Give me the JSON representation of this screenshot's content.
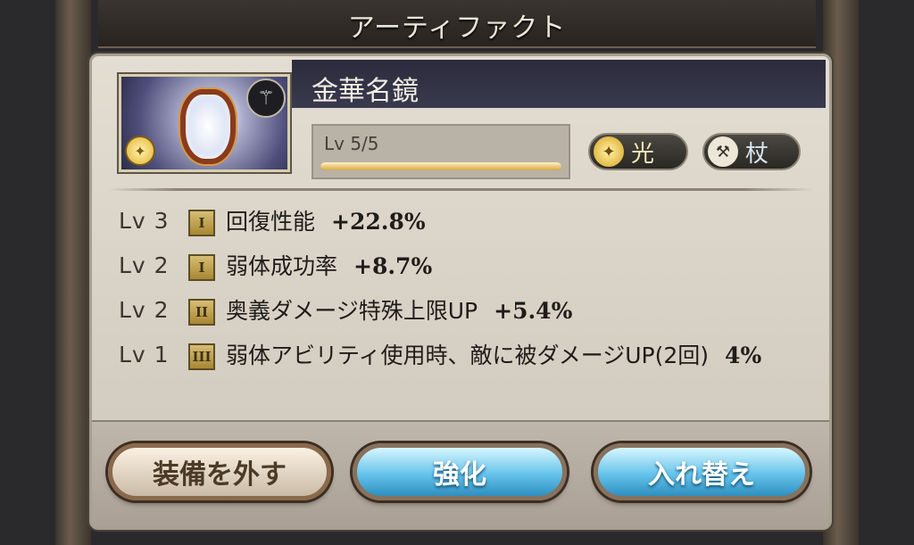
{
  "header": {
    "title": "アーティファクト"
  },
  "artifact": {
    "name": "金華名鏡",
    "level_label": "Lv 5/5",
    "level_progress": 1.0,
    "thumbnail": {
      "image": "ornate-mirror",
      "element_icon": "light-element-icon",
      "weapon_icon": "staff-icon"
    },
    "badges": [
      {
        "icon": "light-element-icon",
        "label": "光"
      },
      {
        "icon": "staff-icon",
        "label": "杖"
      }
    ]
  },
  "skills": [
    {
      "level": "Lv 3",
      "tier": "I",
      "name": "回復性能",
      "value": "+22.8%"
    },
    {
      "level": "Lv 2",
      "tier": "I",
      "name": "弱体成功率",
      "value": "+8.7%"
    },
    {
      "level": "Lv 2",
      "tier": "II",
      "name": "奥義ダメージ特殊上限UP",
      "value": "+5.4%"
    },
    {
      "level": "Lv 1",
      "tier": "III",
      "name": "弱体アビリティ使用時、敵に被ダメージUP(2回)",
      "value": "4%"
    }
  ],
  "buttons": {
    "unequip": "装備を外す",
    "upgrade": "強化",
    "swap": "入れ替え"
  }
}
